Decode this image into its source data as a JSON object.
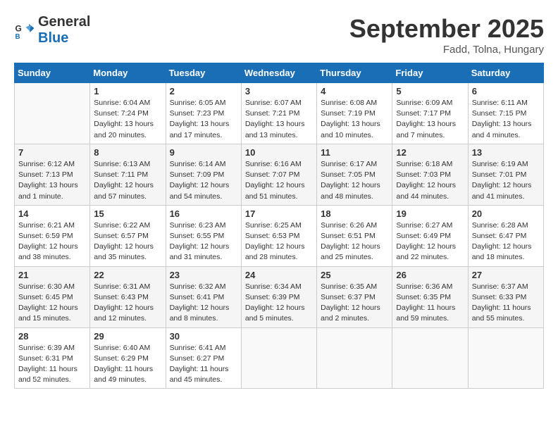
{
  "header": {
    "logo_line1": "General",
    "logo_line2": "Blue",
    "month_title": "September 2025",
    "location": "Fadd, Tolna, Hungary"
  },
  "days_of_week": [
    "Sunday",
    "Monday",
    "Tuesday",
    "Wednesday",
    "Thursday",
    "Friday",
    "Saturday"
  ],
  "weeks": [
    [
      {
        "day": "",
        "sunrise": "",
        "sunset": "",
        "daylight": ""
      },
      {
        "day": "1",
        "sunrise": "Sunrise: 6:04 AM",
        "sunset": "Sunset: 7:24 PM",
        "daylight": "Daylight: 13 hours and 20 minutes."
      },
      {
        "day": "2",
        "sunrise": "Sunrise: 6:05 AM",
        "sunset": "Sunset: 7:23 PM",
        "daylight": "Daylight: 13 hours and 17 minutes."
      },
      {
        "day": "3",
        "sunrise": "Sunrise: 6:07 AM",
        "sunset": "Sunset: 7:21 PM",
        "daylight": "Daylight: 13 hours and 13 minutes."
      },
      {
        "day": "4",
        "sunrise": "Sunrise: 6:08 AM",
        "sunset": "Sunset: 7:19 PM",
        "daylight": "Daylight: 13 hours and 10 minutes."
      },
      {
        "day": "5",
        "sunrise": "Sunrise: 6:09 AM",
        "sunset": "Sunset: 7:17 PM",
        "daylight": "Daylight: 13 hours and 7 minutes."
      },
      {
        "day": "6",
        "sunrise": "Sunrise: 6:11 AM",
        "sunset": "Sunset: 7:15 PM",
        "daylight": "Daylight: 13 hours and 4 minutes."
      }
    ],
    [
      {
        "day": "7",
        "sunrise": "Sunrise: 6:12 AM",
        "sunset": "Sunset: 7:13 PM",
        "daylight": "Daylight: 13 hours and 1 minute."
      },
      {
        "day": "8",
        "sunrise": "Sunrise: 6:13 AM",
        "sunset": "Sunset: 7:11 PM",
        "daylight": "Daylight: 12 hours and 57 minutes."
      },
      {
        "day": "9",
        "sunrise": "Sunrise: 6:14 AM",
        "sunset": "Sunset: 7:09 PM",
        "daylight": "Daylight: 12 hours and 54 minutes."
      },
      {
        "day": "10",
        "sunrise": "Sunrise: 6:16 AM",
        "sunset": "Sunset: 7:07 PM",
        "daylight": "Daylight: 12 hours and 51 minutes."
      },
      {
        "day": "11",
        "sunrise": "Sunrise: 6:17 AM",
        "sunset": "Sunset: 7:05 PM",
        "daylight": "Daylight: 12 hours and 48 minutes."
      },
      {
        "day": "12",
        "sunrise": "Sunrise: 6:18 AM",
        "sunset": "Sunset: 7:03 PM",
        "daylight": "Daylight: 12 hours and 44 minutes."
      },
      {
        "day": "13",
        "sunrise": "Sunrise: 6:19 AM",
        "sunset": "Sunset: 7:01 PM",
        "daylight": "Daylight: 12 hours and 41 minutes."
      }
    ],
    [
      {
        "day": "14",
        "sunrise": "Sunrise: 6:21 AM",
        "sunset": "Sunset: 6:59 PM",
        "daylight": "Daylight: 12 hours and 38 minutes."
      },
      {
        "day": "15",
        "sunrise": "Sunrise: 6:22 AM",
        "sunset": "Sunset: 6:57 PM",
        "daylight": "Daylight: 12 hours and 35 minutes."
      },
      {
        "day": "16",
        "sunrise": "Sunrise: 6:23 AM",
        "sunset": "Sunset: 6:55 PM",
        "daylight": "Daylight: 12 hours and 31 minutes."
      },
      {
        "day": "17",
        "sunrise": "Sunrise: 6:25 AM",
        "sunset": "Sunset: 6:53 PM",
        "daylight": "Daylight: 12 hours and 28 minutes."
      },
      {
        "day": "18",
        "sunrise": "Sunrise: 6:26 AM",
        "sunset": "Sunset: 6:51 PM",
        "daylight": "Daylight: 12 hours and 25 minutes."
      },
      {
        "day": "19",
        "sunrise": "Sunrise: 6:27 AM",
        "sunset": "Sunset: 6:49 PM",
        "daylight": "Daylight: 12 hours and 22 minutes."
      },
      {
        "day": "20",
        "sunrise": "Sunrise: 6:28 AM",
        "sunset": "Sunset: 6:47 PM",
        "daylight": "Daylight: 12 hours and 18 minutes."
      }
    ],
    [
      {
        "day": "21",
        "sunrise": "Sunrise: 6:30 AM",
        "sunset": "Sunset: 6:45 PM",
        "daylight": "Daylight: 12 hours and 15 minutes."
      },
      {
        "day": "22",
        "sunrise": "Sunrise: 6:31 AM",
        "sunset": "Sunset: 6:43 PM",
        "daylight": "Daylight: 12 hours and 12 minutes."
      },
      {
        "day": "23",
        "sunrise": "Sunrise: 6:32 AM",
        "sunset": "Sunset: 6:41 PM",
        "daylight": "Daylight: 12 hours and 8 minutes."
      },
      {
        "day": "24",
        "sunrise": "Sunrise: 6:34 AM",
        "sunset": "Sunset: 6:39 PM",
        "daylight": "Daylight: 12 hours and 5 minutes."
      },
      {
        "day": "25",
        "sunrise": "Sunrise: 6:35 AM",
        "sunset": "Sunset: 6:37 PM",
        "daylight": "Daylight: 12 hours and 2 minutes."
      },
      {
        "day": "26",
        "sunrise": "Sunrise: 6:36 AM",
        "sunset": "Sunset: 6:35 PM",
        "daylight": "Daylight: 11 hours and 59 minutes."
      },
      {
        "day": "27",
        "sunrise": "Sunrise: 6:37 AM",
        "sunset": "Sunset: 6:33 PM",
        "daylight": "Daylight: 11 hours and 55 minutes."
      }
    ],
    [
      {
        "day": "28",
        "sunrise": "Sunrise: 6:39 AM",
        "sunset": "Sunset: 6:31 PM",
        "daylight": "Daylight: 11 hours and 52 minutes."
      },
      {
        "day": "29",
        "sunrise": "Sunrise: 6:40 AM",
        "sunset": "Sunset: 6:29 PM",
        "daylight": "Daylight: 11 hours and 49 minutes."
      },
      {
        "day": "30",
        "sunrise": "Sunrise: 6:41 AM",
        "sunset": "Sunset: 6:27 PM",
        "daylight": "Daylight: 11 hours and 45 minutes."
      },
      {
        "day": "",
        "sunrise": "",
        "sunset": "",
        "daylight": ""
      },
      {
        "day": "",
        "sunrise": "",
        "sunset": "",
        "daylight": ""
      },
      {
        "day": "",
        "sunrise": "",
        "sunset": "",
        "daylight": ""
      },
      {
        "day": "",
        "sunrise": "",
        "sunset": "",
        "daylight": ""
      }
    ]
  ]
}
